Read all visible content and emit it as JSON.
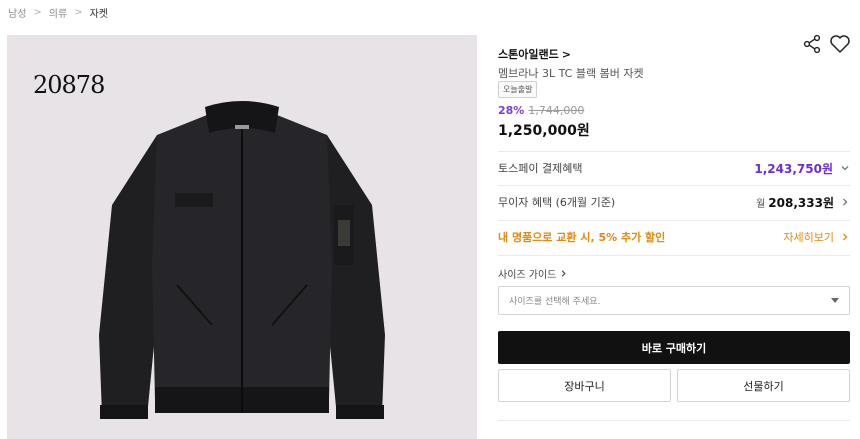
{
  "breadcrumb": {
    "items": [
      "남성",
      "의류",
      "자켓"
    ],
    "separator": ">"
  },
  "image": {
    "overlay_text": "20878",
    "background": "#e7e3e6"
  },
  "product": {
    "brand": "스톤아일랜드",
    "brand_chevron": ">",
    "name": "멤브라나 3L TC 블랙 봄버 자켓",
    "badge": "오늘출발",
    "discount": "28%",
    "original_price": "1,744,000",
    "final_price": "1,250,000원"
  },
  "benefits": {
    "toss_label": "토스페이 결제혜택",
    "toss_value": "1,243,750원",
    "installment_label": "무이자 혜택 (6개월 기준)",
    "installment_prefix": "월",
    "installment_value": "208,333원",
    "trade_label": "내 명품으로 교환 시, 5% 추가 할인",
    "trade_link": "자세히보기"
  },
  "size": {
    "guide_label": "사이즈 가이드",
    "placeholder": "사이즈를 선택해 주세요."
  },
  "actions": {
    "buy_now": "바로 구매하기",
    "cart": "장바구니",
    "gift": "선물하기"
  },
  "icons": {
    "share": "share-icon",
    "wishlist": "heart-icon"
  },
  "colors": {
    "accent_purple": "#6b2fd0",
    "accent_orange": "#e38a10",
    "buy_button": "#111111"
  }
}
